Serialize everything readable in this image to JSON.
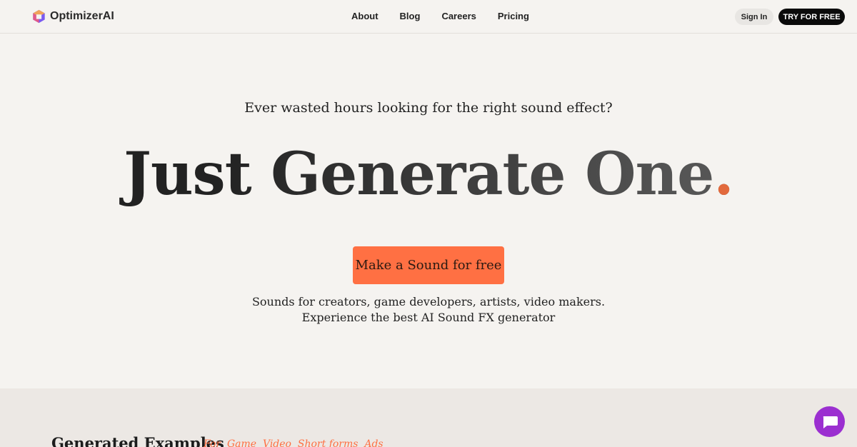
{
  "header": {
    "brand": "OptimizerAI",
    "nav": [
      "About",
      "Blog",
      "Careers",
      "Pricing"
    ],
    "sign_in": "Sign In",
    "try_free": "TRY FOR FREE"
  },
  "hero": {
    "tagline": "Ever wasted hours looking for the right sound effect?",
    "headline": "Just Generate One",
    "headline_dot": ".",
    "cta": "Make a Sound for free",
    "sub_line1": "Sounds for creators, game developers, artists, video makers.",
    "sub_line2": "Experience the best AI Sound FX generator"
  },
  "examples": {
    "title": "Generated Examples",
    "tags": "For  Game  Video  Short forms  Ads"
  },
  "icons": {
    "logo": "cube-logo-icon",
    "chat": "chat-bubble-icon"
  },
  "colors": {
    "background": "#f5f3f0",
    "accent": "#ff7043",
    "chat": "#9b2fd0",
    "dark_button": "#0b0b0b"
  }
}
